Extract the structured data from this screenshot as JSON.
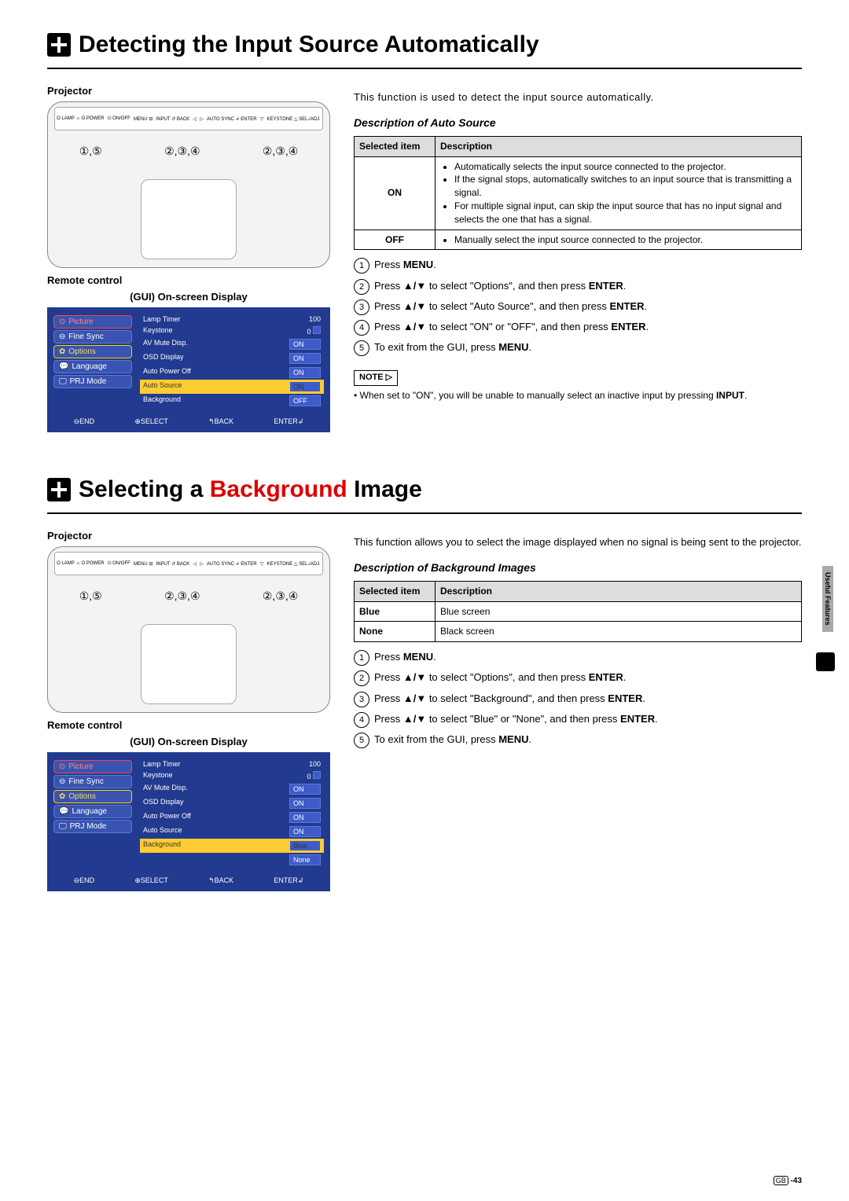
{
  "section1": {
    "heading": "Detecting the Input Source Automatically",
    "projector_label": "Projector",
    "remote_label": "Remote control",
    "gui_label": "(GUI) On-screen Display",
    "callouts_left": "①,⑤",
    "callouts_mid": "②,③,④",
    "callouts_right": "②,③,④",
    "intro": "This function is used to detect the input source automatically.",
    "desc_heading": "Description of Auto Source",
    "table": {
      "head1": "Selected item",
      "head2": "Description",
      "on_label": "ON",
      "on_b1": "Automatically selects the input source connected to the projector.",
      "on_b2": "If the signal stops, automatically switches to an input source that is transmitting a signal.",
      "on_b3": "For multiple signal input, can skip the input source that has no input signal and selects the one that has a signal.",
      "off_label": "OFF",
      "off_b1": "Manually select the input source connected to the projector."
    },
    "step1": "Press MENU.",
    "step2a": "Press ",
    "step2b": " to select \"Options\", and then press ",
    "step2c": "ENTER",
    "step3a": "Press ",
    "step3b": " to select \"Auto Source\", and then press ",
    "step3c": "ENTER",
    "step4a": "Press ",
    "step4b": " to select \"ON\" or \"OFF\", and then press ",
    "step4c": "ENTER",
    "step5": "To exit from the GUI, press MENU.",
    "note_label": "NOTE",
    "note_text": "• When set to \"ON\", you will be unable to manually select an inactive input by pressing INPUT.",
    "gui": {
      "tabs": [
        "Picture",
        "Fine Sync",
        "Options",
        "Language",
        "PRJ Mode"
      ],
      "rows": [
        {
          "name": "Lamp Timer",
          "val": "100"
        },
        {
          "name": "Keystone",
          "val": "0"
        },
        {
          "name": "AV Mute Disp.",
          "val": "ON"
        },
        {
          "name": "OSD Display",
          "val": "ON"
        },
        {
          "name": "Auto Power Off",
          "val": "ON"
        },
        {
          "name": "Auto Source",
          "val": "ON",
          "hl": true
        },
        {
          "name": "Background",
          "val": "OFF"
        }
      ],
      "footer": [
        "⊖END",
        "⊕SELECT",
        "↰BACK",
        "ENTER↲"
      ]
    }
  },
  "section2": {
    "heading_a": "Selecting a ",
    "heading_red": "Background",
    "heading_b": " Image",
    "projector_label": "Projector",
    "remote_label": "Remote control",
    "gui_label": "(GUI) On-screen Display",
    "callouts_left": "①,⑤",
    "callouts_mid": "②,③,④",
    "callouts_right": "②,③,④",
    "intro": "This function allows you to select the image displayed when no signal is being sent to the projector.",
    "desc_heading": "Description of Background Images",
    "table": {
      "head1": "Selected item",
      "head2": "Description",
      "r1a": "Blue",
      "r1b": "Blue screen",
      "r2a": "None",
      "r2b": "Black screen"
    },
    "step1": "Press MENU.",
    "step2a": "Press ",
    "step2b": " to select \"Options\", and then press ",
    "step2c": "ENTER",
    "step3a": "Press ",
    "step3b": " to select \"Background\", and then press ",
    "step3c": "ENTER",
    "step4a": "Press ",
    "step4b": " to select \"Blue\" or \"None\", and then press ",
    "step4c": "ENTER",
    "step5": "To exit from the GUI, press MENU.",
    "gui": {
      "tabs": [
        "Picture",
        "Fine Sync",
        "Options",
        "Language",
        "PRJ Mode"
      ],
      "rows": [
        {
          "name": "Lamp Timer",
          "val": "100"
        },
        {
          "name": "Keystone",
          "val": "0"
        },
        {
          "name": "AV Mute Disp.",
          "val": "ON"
        },
        {
          "name": "OSD Display",
          "val": "ON"
        },
        {
          "name": "Auto Power Off",
          "val": "ON"
        },
        {
          "name": "Auto Source",
          "val": "ON"
        },
        {
          "name": "Background",
          "val": "Blue",
          "hl": true
        }
      ],
      "extra": "None",
      "footer": [
        "⊖END",
        "⊕SELECT",
        "↰BACK",
        "ENTER↲"
      ]
    }
  },
  "side_tab": "Useful Features",
  "page_num": "-43",
  "arrows": "▲/▼"
}
